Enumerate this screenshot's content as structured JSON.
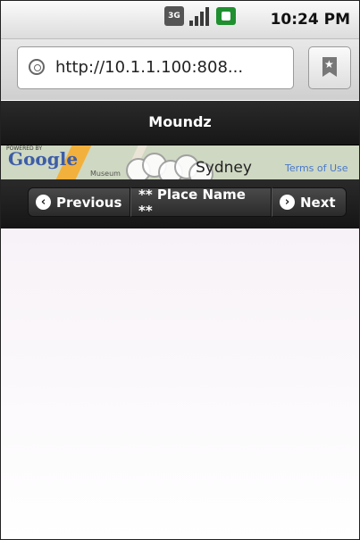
{
  "status_bar": {
    "network_type": "3G",
    "signal_icon": "signal-bars-icon",
    "battery_icon": "battery-charging-icon",
    "time": "10:24 PM"
  },
  "browser": {
    "url": "http://10.1.1.100:808...",
    "globe_icon": "globe-icon",
    "bookmark_icon": "bookmark-star-icon"
  },
  "app": {
    "title": "Moundz"
  },
  "map": {
    "attribution_small": "POWERED BY",
    "logo": "Google",
    "place_label": "Sydney",
    "poi_label": "Museum",
    "terms_label": "Terms of Use"
  },
  "toolbar": {
    "prev_label": "Previous",
    "place_name": "** Place Name **",
    "next_label": "Next"
  },
  "colors": {
    "header_bg": "#1e1e1e",
    "map_bg": "#cfd8c2",
    "accent_road": "#f2b13c"
  }
}
